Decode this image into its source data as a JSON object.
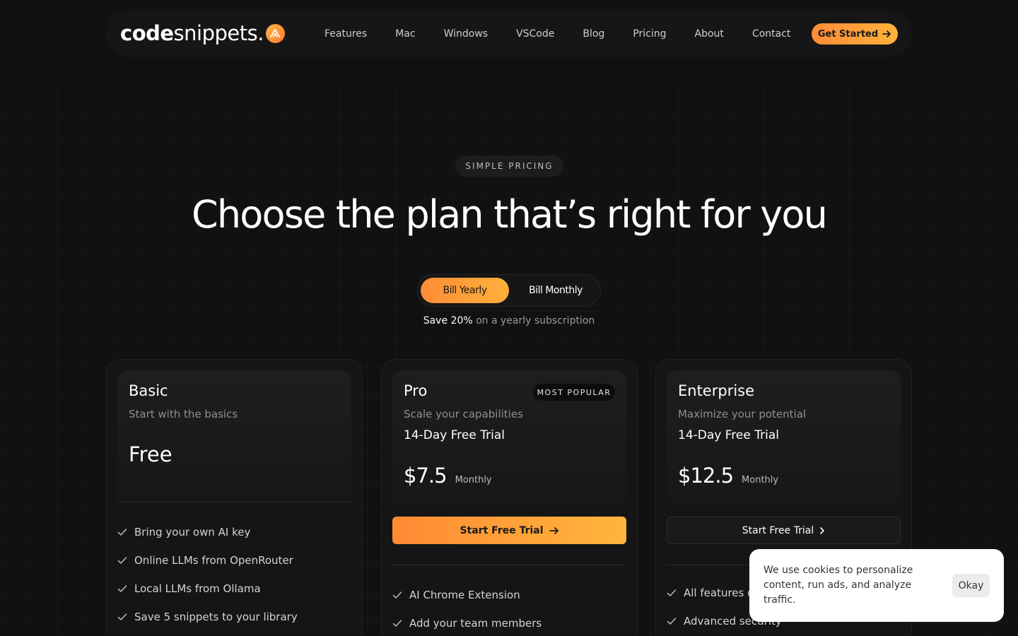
{
  "brand": {
    "logo_bold": "code",
    "logo_light": "snippets."
  },
  "nav": {
    "links": [
      "Features",
      "Mac",
      "Windows",
      "VSCode",
      "Blog",
      "Pricing",
      "About",
      "Contact"
    ],
    "cta": "Get Started"
  },
  "hero": {
    "eyebrow": "SIMPLE PRICING",
    "headline": "Choose the plan that’s right for you"
  },
  "billing": {
    "yearly": "Bill Yearly",
    "monthly": "Bill Monthly",
    "selected": "yearly",
    "save_strong": "Save 20%",
    "save_rest": " on a yearly subscription"
  },
  "plans": [
    {
      "name": "Basic",
      "tagline": "Start with the basics",
      "price": "Free",
      "features": [
        "Bring your own AI key",
        "Online LLMs from OpenRouter",
        "Local LLMs from Ollama",
        "Save 5 snippets to your library"
      ]
    },
    {
      "name": "Pro",
      "badge": "MOST POPULAR",
      "tagline": "Scale your capabilities",
      "trial": "14-Day Free Trial",
      "price": "$7.5",
      "period": "Monthly",
      "cta": "Start Free Trial",
      "features": [
        "AI Chrome Extension",
        "Add your team members"
      ]
    },
    {
      "name": "Enterprise",
      "tagline": "Maximize your potential",
      "trial": "14-Day Free Trial",
      "price": "$12.5",
      "period": "Monthly",
      "cta": "Start Free Trial",
      "features": [
        "All features o",
        "Advanced security"
      ]
    }
  ],
  "cookie": {
    "text": "We use cookies to personalize content, run ads, and analyze traffic.",
    "button": "Okay"
  },
  "colors": {
    "accent_start": "#ff8c37",
    "accent_end": "#ffb13b",
    "background": "#111111"
  }
}
